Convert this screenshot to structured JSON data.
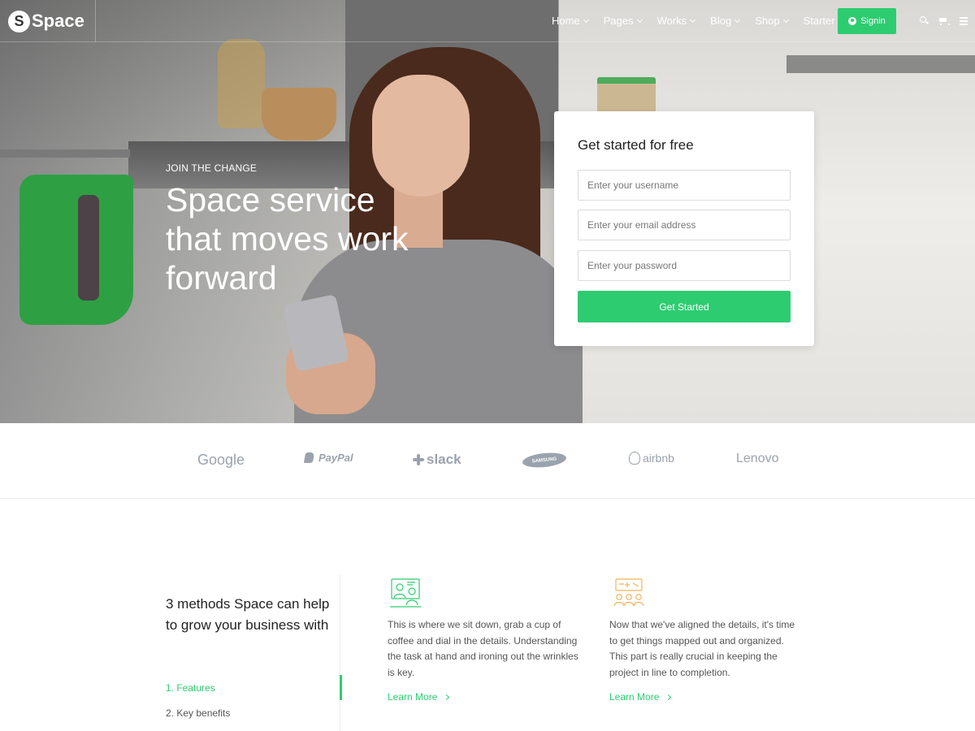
{
  "brand": {
    "logo_letter": "S",
    "name": "Space"
  },
  "nav": {
    "items": [
      {
        "label": "Home",
        "has_dropdown": true
      },
      {
        "label": "Pages",
        "has_dropdown": true
      },
      {
        "label": "Works",
        "has_dropdown": true
      },
      {
        "label": "Blog",
        "has_dropdown": true
      },
      {
        "label": "Shop",
        "has_dropdown": true
      },
      {
        "label": "Starter",
        "has_dropdown": false
      }
    ],
    "signin_label": "Signin",
    "icons": [
      "user-icon",
      "search-icon",
      "cart-icon",
      "menu-icon"
    ]
  },
  "hero": {
    "eyebrow": "JOIN THE CHANGE",
    "headline": "Space service that moves work forward"
  },
  "signup": {
    "title": "Get started for free",
    "username_placeholder": "Enter your username",
    "email_placeholder": "Enter your email address",
    "password_placeholder": "Enter your password",
    "submit_label": "Get Started"
  },
  "brands": {
    "logos": [
      "Google",
      "PayPal",
      "slack",
      "SAMSUNG",
      "airbnb",
      "Lenovo"
    ]
  },
  "features": {
    "title": "3 methods Space can help to grow your business with",
    "tabs": [
      "1. Features",
      "2. Key benefits"
    ],
    "active_tab": 0,
    "items": [
      {
        "icon": "presentation-icon",
        "text": "This is where we sit down, grab a cup of coffee and dial in the details. Understanding the task at hand and ironing out the wrinkles is key.",
        "link": "Learn More"
      },
      {
        "icon": "team-icon",
        "text": "Now that we've aligned the details, it's time to get things mapped out and organized. This part is really crucial in keeping the project in line to completion.",
        "link": "Learn More"
      }
    ]
  },
  "colors": {
    "accent": "#2ecc71",
    "brand_grey": "#9aa3ad"
  }
}
